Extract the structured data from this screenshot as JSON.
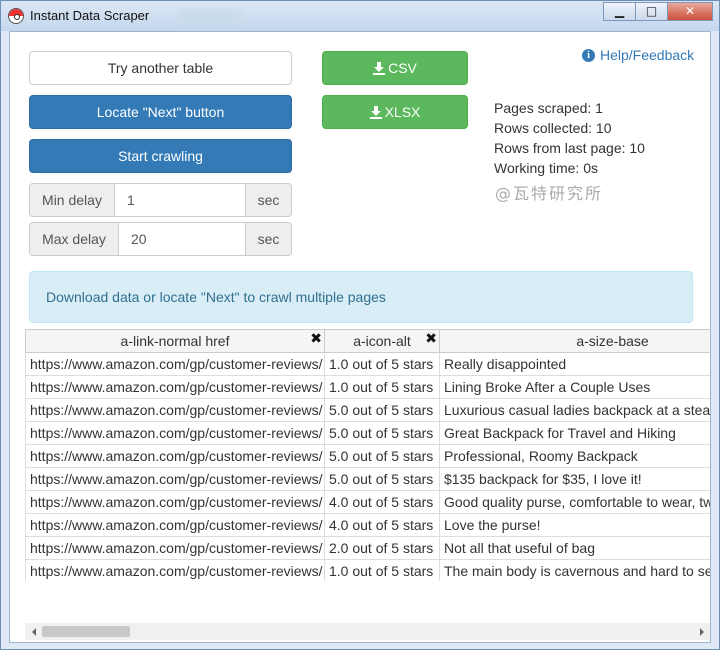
{
  "window": {
    "title": "Instant Data Scraper",
    "minimize_glyph": "▁",
    "maximize_glyph": "□",
    "close_glyph": "✕"
  },
  "buttons": {
    "try_another": "Try another table",
    "locate_next": "Locate \"Next\" button",
    "start_crawling": "Start crawling",
    "csv": "CSV",
    "xlsx": "XLSX"
  },
  "delays": {
    "min_label": "Min delay",
    "min_value": "1",
    "max_label": "Max delay",
    "max_value": "20",
    "unit": "sec"
  },
  "help": {
    "icon": "info-icon",
    "label": "Help/Feedback"
  },
  "stats": {
    "pages_scraped": "Pages scraped: 1",
    "rows_collected": "Rows collected: 10",
    "rows_last_page": "Rows from last page: 10",
    "working_time": "Working time: 0s"
  },
  "watermark": "@瓦特研究所",
  "alert": "Download data or locate \"Next\" to crawl multiple pages",
  "table": {
    "columns": [
      "a-link-normal href",
      "a-icon-alt",
      "a-size-base"
    ],
    "rows": [
      [
        "https://www.amazon.com/gp/customer-reviews/",
        "1.0 out of 5 stars",
        "Really disappointed"
      ],
      [
        "https://www.amazon.com/gp/customer-reviews/",
        "1.0 out of 5 stars",
        "Lining Broke After a Couple Uses"
      ],
      [
        "https://www.amazon.com/gp/customer-reviews/",
        "5.0 out of 5 stars",
        "Luxurious casual ladies backpack at a steal"
      ],
      [
        "https://www.amazon.com/gp/customer-reviews/",
        "5.0 out of 5 stars",
        "Great Backpack for Travel and Hiking"
      ],
      [
        "https://www.amazon.com/gp/customer-reviews/",
        "5.0 out of 5 stars",
        "Professional, Roomy Backpack"
      ],
      [
        "https://www.amazon.com/gp/customer-reviews/",
        "5.0 out of 5 stars",
        "$135 backpack for $35, I love it!"
      ],
      [
        "https://www.amazon.com/gp/customer-reviews/",
        "4.0 out of 5 stars",
        "Good quality purse, comfortable to wear, two"
      ],
      [
        "https://www.amazon.com/gp/customer-reviews/",
        "4.0 out of 5 stars",
        "Love the purse!"
      ],
      [
        "https://www.amazon.com/gp/customer-reviews/",
        "2.0 out of 5 stars",
        "Not all that useful of bag"
      ],
      [
        "https://www.amazon.com/gp/customer-reviews/",
        "1.0 out of 5 stars",
        "The main body is cavernous and hard to see"
      ]
    ]
  },
  "colors": {
    "primary": "#337ab7",
    "success": "#5cb85c",
    "alert_bg": "#d9edf7",
    "alert_text": "#31708f"
  }
}
